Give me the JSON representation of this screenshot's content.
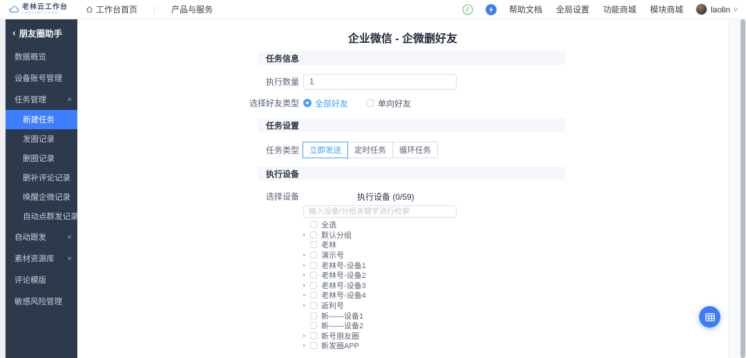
{
  "colors": {
    "accent_blue": "#409eff",
    "sidebar_bg": "#2d3a4b",
    "sidebar_active_bg": "#3d7eff",
    "section_bar_bg": "#f6f7fa",
    "fab_blue": "#3e7cf7",
    "nav_icon_green": "#5fc75d"
  },
  "navbar": {
    "logo_title": "老林云工作台",
    "logo_subtitle": "LAOLINCLOUD",
    "link_home": "工作台首页",
    "link_products": "产品与服务",
    "right_links": [
      "帮助文档",
      "全局设置",
      "功能商城",
      "模块商城"
    ],
    "username": "laolin",
    "user_caret": "∨"
  },
  "sidebar": {
    "back_icon": "‹",
    "title": "朋友圈助手",
    "items": [
      {
        "label": "数据概览",
        "sub": false,
        "active": false,
        "chevron": ""
      },
      {
        "label": "设备账号管理",
        "sub": false,
        "active": false,
        "chevron": ""
      },
      {
        "label": "任务管理",
        "sub": false,
        "active": false,
        "chevron": "∧"
      },
      {
        "label": "新建任务",
        "sub": true,
        "active": true,
        "chevron": ""
      },
      {
        "label": "发圈记录",
        "sub": true,
        "active": false,
        "chevron": ""
      },
      {
        "label": "删圈记录",
        "sub": true,
        "active": false,
        "chevron": ""
      },
      {
        "label": "删补评论记录",
        "sub": true,
        "active": false,
        "chevron": ""
      },
      {
        "label": "唤醒企微记录",
        "sub": true,
        "active": false,
        "chevron": ""
      },
      {
        "label": "自动点群发记录",
        "sub": true,
        "active": false,
        "chevron": ""
      },
      {
        "label": "自动跟发",
        "sub": false,
        "active": false,
        "chevron": "∨"
      },
      {
        "label": "素材资源库",
        "sub": false,
        "active": false,
        "chevron": "∨"
      },
      {
        "label": "评论模版",
        "sub": false,
        "active": false,
        "chevron": ""
      },
      {
        "label": "敏感风险管理",
        "sub": false,
        "active": false,
        "chevron": ""
      }
    ]
  },
  "main": {
    "page_title": "企业微信 - 企微删好友",
    "sections": {
      "task_info": "任务信息",
      "task_settings": "任务设置",
      "exec_device": "执行设备"
    },
    "exec_count": {
      "label": "执行数量",
      "value": "1"
    },
    "friend_type": {
      "label": "选择好友类型",
      "options": [
        {
          "label": "全部好友",
          "selected": true
        },
        {
          "label": "单向好友",
          "selected": false
        }
      ]
    },
    "task_type": {
      "label": "任务类型",
      "options": [
        {
          "label": "立即发送",
          "selected": true
        },
        {
          "label": "定时任务",
          "selected": false
        },
        {
          "label": "循环任务",
          "selected": false
        }
      ]
    },
    "device": {
      "label": "选择设备",
      "panel_title": "执行设备 (0/59)",
      "search_placeholder": "输入设备/分组关键字进行检索",
      "tree": [
        {
          "label": "全选",
          "arrow": ""
        },
        {
          "label": "默认分组",
          "arrow": "▸"
        },
        {
          "label": "老林",
          "arrow": ""
        },
        {
          "label": "演示号",
          "arrow": "▸"
        },
        {
          "label": "老林号-设备1",
          "arrow": "▸"
        },
        {
          "label": "老林号-设备2",
          "arrow": "▸"
        },
        {
          "label": "老林号-设备3",
          "arrow": "▸"
        },
        {
          "label": "老林号-设备4",
          "arrow": "▸"
        },
        {
          "label": "返利号",
          "arrow": "▸"
        },
        {
          "label": "新——设备1",
          "arrow": ""
        },
        {
          "label": "新——设备2",
          "arrow": ""
        },
        {
          "label": "新号朋友圈",
          "arrow": "▸"
        },
        {
          "label": "新发圈APP",
          "arrow": "▸"
        }
      ]
    }
  }
}
